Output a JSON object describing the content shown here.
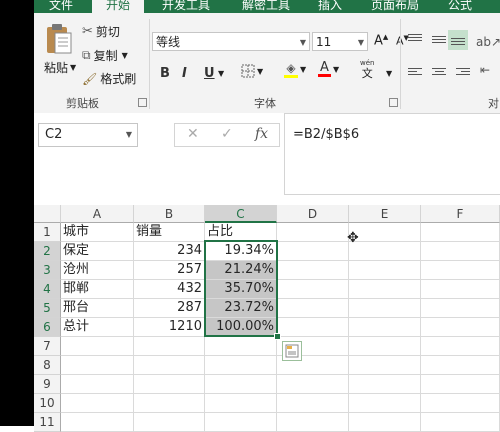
{
  "ribbon": {
    "tabs": [
      "文件",
      "开始",
      "开发工具",
      "解密工具",
      "插入",
      "页面布局",
      "公式"
    ],
    "active_tab": "开始",
    "clipboard": {
      "paste": "粘贴",
      "cut": "剪切",
      "copy": "复制",
      "format_painter": "格式刷",
      "group": "剪贴板"
    },
    "font": {
      "family": "等线",
      "size": "11",
      "bold": "B",
      "italic": "I",
      "underline": "U",
      "wen": "wén",
      "wen_char": "文",
      "group": "字体"
    },
    "align_group": "对"
  },
  "formula_bar": {
    "name_box": "C2",
    "cancel": "✕",
    "enter": "✓",
    "fx": "fx",
    "formula": "=B2/$B$6"
  },
  "sheet": {
    "columns": [
      "A",
      "B",
      "C",
      "D",
      "E",
      "F"
    ],
    "rows": [
      "1",
      "2",
      "3",
      "4",
      "5",
      "6",
      "7",
      "8",
      "9",
      "10",
      "11"
    ],
    "cells": [
      [
        "城市",
        "销量",
        "占比"
      ],
      [
        "保定",
        "234",
        "19.34%"
      ],
      [
        "沧州",
        "257",
        "21.24%"
      ],
      [
        "邯郸",
        "432",
        "35.70%"
      ],
      [
        "邢台",
        "287",
        "23.72%"
      ],
      [
        "总计",
        "1210",
        "100.00%"
      ]
    ],
    "selection": "C2:C6",
    "colors": {
      "accent": "#217346",
      "selection_fill": "#c6c6c6"
    }
  }
}
